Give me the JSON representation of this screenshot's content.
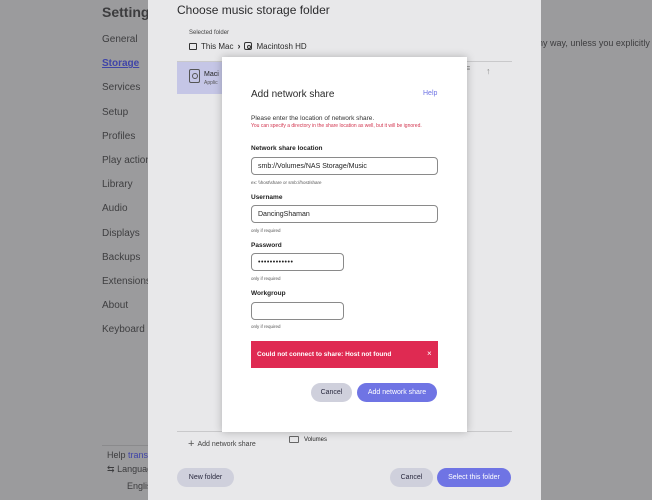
{
  "settings": {
    "title": "Settings",
    "nav": [
      {
        "label": "General",
        "active": false
      },
      {
        "label": "Storage",
        "active": true
      },
      {
        "label": "Services",
        "active": false
      },
      {
        "label": "Setup",
        "active": false
      },
      {
        "label": "Profiles",
        "active": false
      },
      {
        "label": "Play actions",
        "active": false
      },
      {
        "label": "Library",
        "active": false
      },
      {
        "label": "Audio",
        "active": false
      },
      {
        "label": "Displays",
        "active": false
      },
      {
        "label": "Backups",
        "active": false
      },
      {
        "label": "Extensions",
        "active": false
      },
      {
        "label": "About",
        "active": false
      },
      {
        "label": "Keyboard short",
        "active": false
      }
    ],
    "right_text": "ny way, unless you explicitly",
    "help_prefix": "Help",
    "help_link": "translat",
    "language_label": "Languag",
    "language_value": "English"
  },
  "folder_dialog": {
    "title": "Choose music storage folder",
    "selected_label": "Selected folder",
    "crumbs": [
      "This Mac",
      "Macintosh HD"
    ],
    "list_item_name": "Maci",
    "list_item_sub": "Applic",
    "add_share_label": "Add network share",
    "volumes_label": "Volumes",
    "new_folder_label": "New folder",
    "cancel_label": "Cancel",
    "select_label": "Select this folder"
  },
  "modal": {
    "title": "Add network share",
    "help": "Help",
    "description": "Please enter the location of network share.",
    "description_sub": "You can specify a directory in the share location as well, but it will be ignored.",
    "location_label": "Network share location",
    "location_value": "smb://Volumes/NAS Storage/Music",
    "location_hint": "ex: \\\\host\\share or smb://host/share",
    "username_label": "Username",
    "username_value": "DancingShaman",
    "username_hint": "only if required",
    "password_label": "Password",
    "password_value": "••••••••••••",
    "password_hint": "only if required",
    "workgroup_label": "Workgroup",
    "workgroup_value": "",
    "workgroup_hint": "only if required",
    "error_text": "Could not connect to share: Host not found",
    "error_close": "×",
    "cancel_label": "Cancel",
    "submit_label": "Add network share"
  },
  "colors": {
    "accent": "#6f74e4",
    "error": "#df2a52",
    "selection": "#c5c6e6"
  }
}
